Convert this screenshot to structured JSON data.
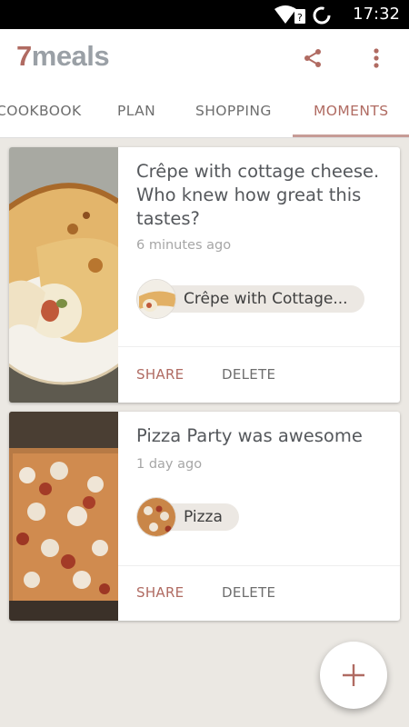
{
  "status_bar": {
    "time": "17:32",
    "icons": [
      "wifi-icon",
      "no-sim-icon",
      "loading-circle-icon"
    ]
  },
  "app": {
    "logo_number": "7",
    "logo_word": "meals"
  },
  "toolbar": {
    "share_icon": "share-icon",
    "more_icon": "more-vert-icon"
  },
  "tabs": [
    {
      "label": "COOKBOOK",
      "active": false
    },
    {
      "label": "PLAN",
      "active": false
    },
    {
      "label": "SHOPPING",
      "active": false
    },
    {
      "label": "MOMENTS",
      "active": true
    }
  ],
  "moments": [
    {
      "title": "Crêpe with cottage cheese. Who knew how great this tastes?",
      "time": "6 minutes ago",
      "recipe": "Crêpe with Cottage...",
      "share_label": "SHARE",
      "delete_label": "DELETE"
    },
    {
      "title": "Pizza Party was awesome",
      "time": "1 day ago",
      "recipe": "Pizza",
      "share_label": "SHARE",
      "delete_label": "DELETE"
    }
  ],
  "fab": {
    "icon": "plus-icon"
  },
  "colors": {
    "accent": "#b06b62",
    "background": "#ebe8e3",
    "tab_underline": "#c69c96"
  }
}
